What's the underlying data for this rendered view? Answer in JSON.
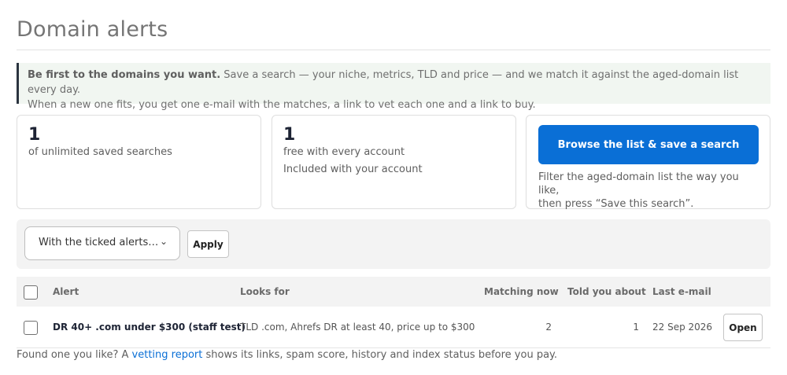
{
  "page": {
    "title": "Domain alerts"
  },
  "intro": {
    "lead": "Be first to the domains you want.",
    "line1_rest": " Save a search — your niche, metrics, TLD and price — and we match it against the aged-domain list every day.",
    "line2": "When a new one fits, you get one e-mail with the matches, a link to vet each one and a link to buy."
  },
  "stats": {
    "saved": {
      "value": "1",
      "label": "of unlimited saved searches"
    },
    "free": {
      "value": "1",
      "label": "free with every account",
      "note": "Included with your account"
    }
  },
  "browse": {
    "button_label": "Browse the list & save a search",
    "desc_line1": "Filter the aged-domain list the way you like,",
    "desc_line2": "then press “Save this search”."
  },
  "bulk": {
    "selected": "With the ticked alerts…",
    "apply_label": "Apply"
  },
  "table": {
    "headers": {
      "alert": "Alert",
      "looks_for": "Looks for",
      "matching_now": "Matching now",
      "told_you_about": "Told you about",
      "last_email": "Last e-mail"
    },
    "rows": [
      {
        "alert": "DR 40+ .com under $300 (staff test)",
        "looks_for": "TLD .com, Ahrefs DR at least 40, price up to $300",
        "matching_now": "2",
        "told_you_about": "1",
        "last_email": "22 Sep 2026",
        "action_label": "Open"
      }
    ]
  },
  "footer": {
    "before": "Found one you like? A ",
    "link": "vetting report",
    "after": " shows its links, spam score, history and index status before you pay."
  },
  "colors": {
    "accent": "#0a6fd6",
    "intro_bg": "#f1f6f1",
    "intro_bar": "#2b3440"
  }
}
